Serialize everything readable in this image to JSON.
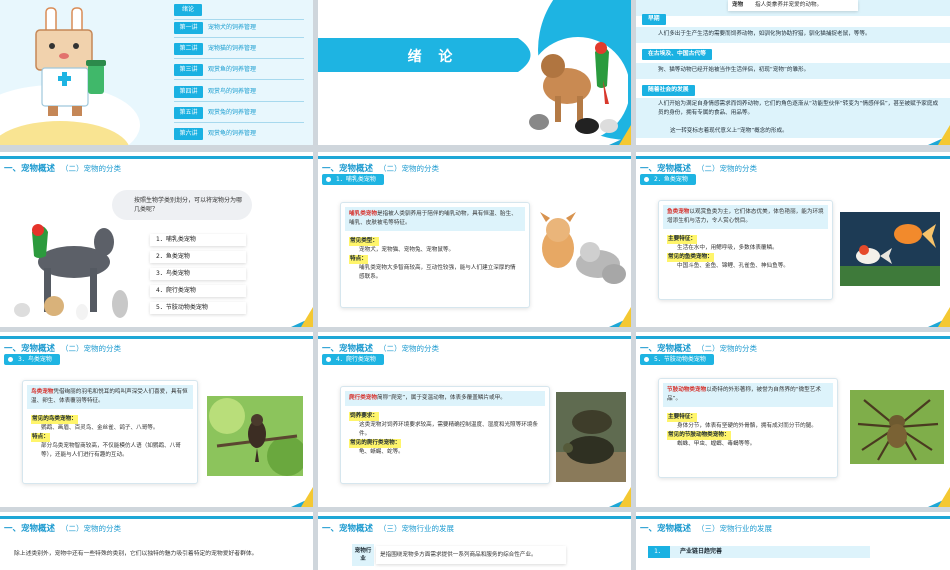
{
  "slides": {
    "toc": {
      "head": "绪论",
      "items": [
        {
          "num": "第一讲",
          "label": "宠物犬的饲养管理"
        },
        {
          "num": "第二讲",
          "label": "宠物猫的饲养管理"
        },
        {
          "num": "第三讲",
          "label": "观赏鱼的饲养管理"
        },
        {
          "num": "第四讲",
          "label": "观赏鸟的饲养管理"
        },
        {
          "num": "第五讲",
          "label": "观赏兔的饲养管理"
        },
        {
          "num": "第六讲",
          "label": "观赏龟的饲养管理"
        }
      ]
    },
    "intro": {
      "title": "绪 论"
    },
    "history": {
      "top_label": "宠物",
      "top_text": "指人类豢养并宠爱的动物。",
      "sections": [
        {
          "head": "早期",
          "text": "人们多出于生产生活的需要而饲养动物，如驯化狗协助狩猎，驯化猫捕捉老鼠，等等。"
        },
        {
          "head": "在古埃及、中国古代等",
          "text": "狗、猫等动物已经开始被当作生活伴侣，初现“宠物”的雏形。"
        },
        {
          "head": "随着社会的发展",
          "text": "人们开始为满足自身情感需求而饲养动物，它们的角色逐渐从“功能型伙伴”转变为“情感伴侣”，甚至被赋予家庭成员的身份，拥有专属的食品、用品等。",
          "text2": "这一转变标志着现代意义上“宠物”概念的形成。"
        }
      ]
    },
    "header_main": "一、宠物概述",
    "header_sub_class": "（二）宠物的分类",
    "header_sub_industry": "（三）宠物行业的发展",
    "classify": {
      "question": "按照生物学类别划分，可以将宠物分为哪几类呢？",
      "items": [
        "1．哺乳类宠物",
        "2．鱼类宠物",
        "3．鸟类宠物",
        "4．爬行类宠物",
        "5．节肢动物类宠物"
      ]
    },
    "mammal": {
      "tag": "1．哺乳类宠物",
      "term": "哺乳类宠物",
      "def": "是指被人类驯养用于陪伴的哺乳动物，具有恒温、胎生、哺乳、皮肤被毛等特征。",
      "types_head": "常见类型：",
      "types": "宠物犬，宠物猫、宠物兔、宠物鼠等。",
      "feat_head": "特点：",
      "feat": "哺乳类宠物大多智商较高，互动性较强，能与人们建立深厚的情感联系。"
    },
    "fish": {
      "tag": "2．鱼类宠物",
      "term": "鱼类宠物",
      "def": "以观赏鱼类为主，它们体态优美，体色艳丽，能为环境增添生机与活力，令人赏心悦目。",
      "feat_head": "主要特征：",
      "feat": "生活在水中，用鳃呼吸，多数体表覆鳞。",
      "types_head": "常见的鱼类宠物：",
      "types": "中国斗鱼、金鱼、锦鲤、孔雀鱼、神仙鱼等。"
    },
    "bird": {
      "tag": "3．鸟类宠物",
      "term": "鸟类宠物",
      "def": "凭借绚丽的羽毛和悦耳的鸣叫声深受人们喜爱，具有恒温、卵生、体表覆羽等特征。",
      "types_head": "常见的鸟类宠物：",
      "types": "鹦鹉、画眉、百灵鸟、金丝雀、鸽子、八哥等。",
      "feat_head": "特点：",
      "feat": "部分鸟类宠物智商较高，不仅能模仿人语（如鹦鹉、八哥等），还能与人们进行有趣的互动。"
    },
    "reptile": {
      "tag": "4．爬行类宠物",
      "term": "爬行类宠物",
      "def": "简称“爬宠”，属于变温动物，体表多覆盖鳞片或甲。",
      "need_head": "饲养要求：",
      "need": "这类宠物对饲养环境要求较高，需要精确控制温度、湿度和光照等环境条件。",
      "types_head": "常见的爬行类宠物：",
      "types": "龟、蜥蜴、蛇等。"
    },
    "arthropod": {
      "tag": "5．节肢动物类宠物",
      "term": "节肢动物类宠物",
      "def": "以奇特的外形著称，被誉为自然界的“微型艺术品”。",
      "feat_head": "主要特征：",
      "feat": "身体分节，体表有坚硬的外骨骼，拥有成对而分节的腿。",
      "types_head": "常见的节肢动物类宠物：",
      "types": "蜘蛛、甲虫、螳螂、毒蝎等等。"
    },
    "other": {
      "text": "除上述类别外，宠物中还有一些特殊的类别，它们以独特的魅力吸引着特定的宠物爱好者群体。"
    },
    "industry": {
      "label": "宠物行业",
      "text": "是指围绕宠物多方面需求提供一系列商品和服务的综合性产业。"
    },
    "industry2": {
      "num": "1．",
      "text": "产业链日趋完善"
    }
  },
  "colors": {
    "accent": "#1eb4e2",
    "header": "#1e9bd0",
    "highlight": "#fff56b",
    "red": "#d6322d"
  }
}
